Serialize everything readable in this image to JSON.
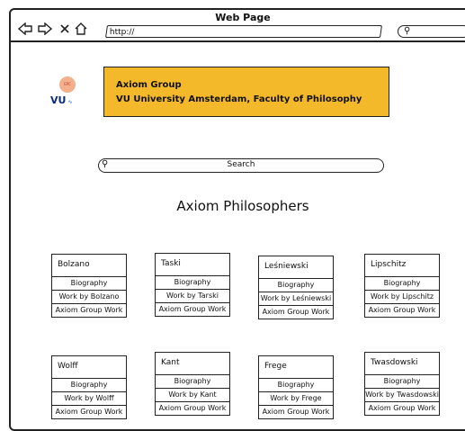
{
  "browser": {
    "title": "Web Page",
    "url": "http://"
  },
  "header": {
    "logo_circle_text": "EPC",
    "logo_text": "VU",
    "line1": "Axiom Group",
    "line2": "VU University Amsterdam, Faculty of Philosophy"
  },
  "search": {
    "label": "Search"
  },
  "page": {
    "title": "Axiom Philosophers"
  },
  "philosophers": [
    {
      "name": "Bolzano",
      "bio": "Biography",
      "work": "Work by Bolzano",
      "group": "Axiom Group Work"
    },
    {
      "name": "Taski",
      "bio": "Biography",
      "work": "Work by Tarski",
      "group": "Axiom Group Work"
    },
    {
      "name": "Leśniewski",
      "bio": "Biography",
      "work": "Work by Leśniewski",
      "group": "Axiom Group Work"
    },
    {
      "name": "Lipschitz",
      "bio": "Biography",
      "work": "Work by Lipschitz",
      "group": "Axiom Group Work"
    },
    {
      "name": "Wolff",
      "bio": "Biography",
      "work": "Work by Wolff",
      "group": "Axiom Group Work"
    },
    {
      "name": "Kant",
      "bio": "Biography",
      "work": "Work by Kant",
      "group": "Axiom Group Work"
    },
    {
      "name": "Frege",
      "bio": "Biography",
      "work": "Work by Frege",
      "group": "Axiom Group Work"
    },
    {
      "name": "Twasdowski",
      "bio": "Biography",
      "work": "Work by Twasdowski",
      "group": "Axiom Group Work"
    }
  ]
}
